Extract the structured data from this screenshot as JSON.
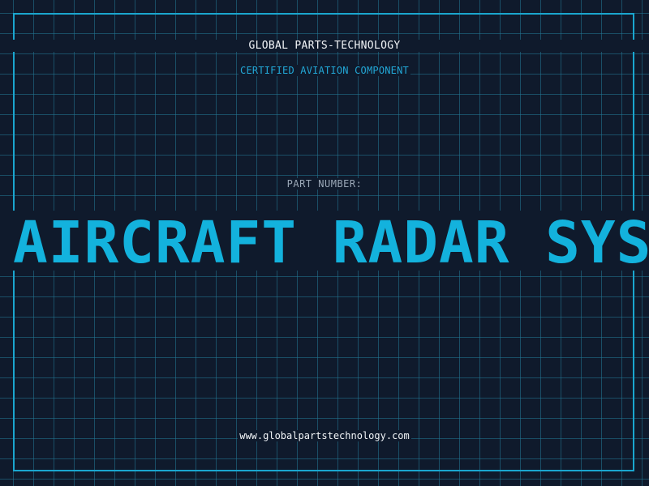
{
  "header": {
    "company_name": "GLOBAL PARTS-TECHNOLOGY",
    "subtitle": "CERTIFIED AVIATION COMPONENT"
  },
  "part": {
    "label": "PART NUMBER:",
    "value": "AIRCRAFT RADAR SYS"
  },
  "footer": {
    "website": "www.globalpartstechnology.com"
  },
  "colors": {
    "background": "#0f1a2c",
    "grid": "#1f6f8a",
    "frame": "#1aa6cf",
    "accent": "#13b2dd",
    "text_primary": "#f2f5f8",
    "text_muted": "#9aa7b6"
  }
}
